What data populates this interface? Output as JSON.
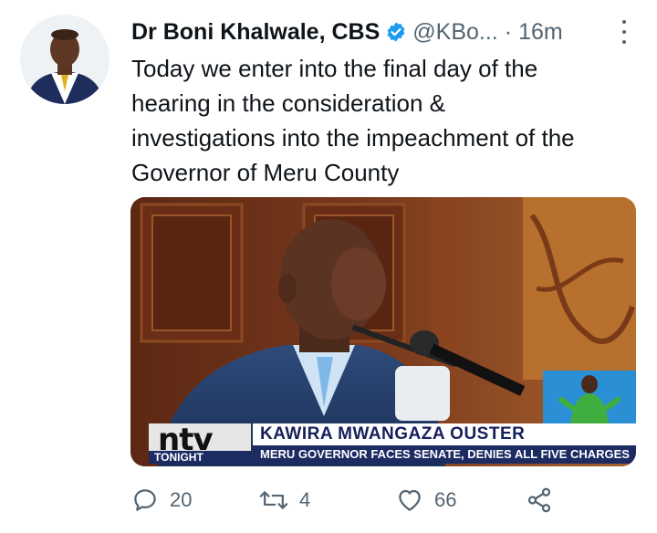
{
  "author": {
    "name": "Dr Boni Khalwale, CBS",
    "handle": "@KBo...",
    "separator": "·",
    "time": "16m",
    "verified": true
  },
  "tweet": {
    "text": "Today we enter into the final day of the\nhearing in the consideration &\ninvestigations into the impeachment of the\nGovernor  of Meru County"
  },
  "media": {
    "logo": "ntv",
    "logo_sub": "TONIGHT",
    "headline": "KAWIRA MWANGAZA OUSTER",
    "subheadline": "MERU GOVERNOR FACES SENATE, DENIES ALL FIVE CHARGES"
  },
  "actions": {
    "reply_count": "20",
    "retweet_count": "4",
    "like_count": "66"
  },
  "colors": {
    "verified": "#1d9bf0",
    "icon_gray": "#536471",
    "banner_navy": "#1d2b63"
  }
}
